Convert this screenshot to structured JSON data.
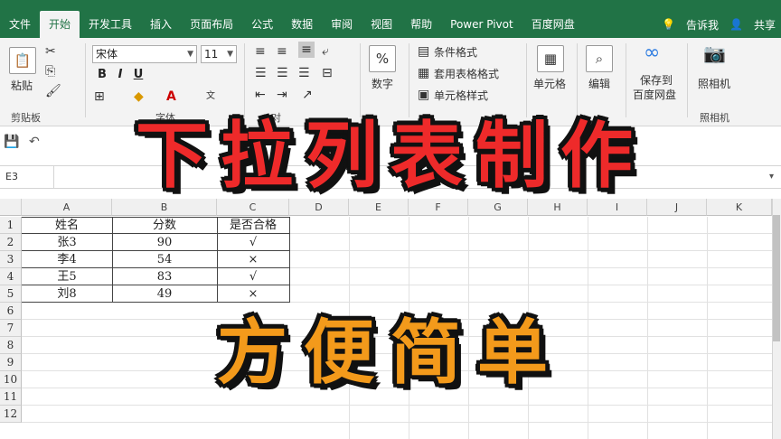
{
  "tabs": [
    "文件",
    "开始",
    "开发工具",
    "插入",
    "页面布局",
    "公式",
    "数据",
    "审阅",
    "视图",
    "帮助",
    "Power Pivot",
    "百度网盘"
  ],
  "active_tab_index": 1,
  "tell_me": "告诉我",
  "share": "共享",
  "ribbon": {
    "paste_label": "粘贴",
    "clipboard_group": "剪贴板",
    "font_name": "宋体",
    "font_size": "11",
    "font_group_partial": "字体",
    "align_group_partial": "对",
    "number_label": "数字",
    "number_icon_text": "%",
    "conditional_format": "条件格式",
    "table_format": "套用表格格式",
    "cell_style": "单元格样式",
    "cells_label": "单元格",
    "edit_label": "编辑",
    "save_baidu_line1": "保存到",
    "save_baidu_line2": "百度网盘",
    "camera_label": "照相机",
    "camera_group_partial": "照相机"
  },
  "name_box": "E3",
  "columns": [
    "A",
    "B",
    "C",
    "D",
    "E",
    "F",
    "G",
    "H",
    "I",
    "J",
    "K"
  ],
  "rows": [
    "1",
    "2",
    "3",
    "4",
    "5",
    "6",
    "7",
    "8",
    "9",
    "10",
    "11",
    "12"
  ],
  "table": {
    "headers": [
      "姓名",
      "分数",
      "是否合格"
    ],
    "rows": [
      [
        "张3",
        "90",
        "√"
      ],
      [
        "李4",
        "54",
        "×"
      ],
      [
        "王5",
        "83",
        "√"
      ],
      [
        "刘8",
        "49",
        "×"
      ]
    ]
  },
  "overlay": {
    "title_main": "下拉列表制作",
    "title_sub": "方便简单"
  },
  "colors": {
    "ribbon_green": "#217346",
    "title_red": "#ee2a2a",
    "title_orange": "#f39a1b"
  }
}
